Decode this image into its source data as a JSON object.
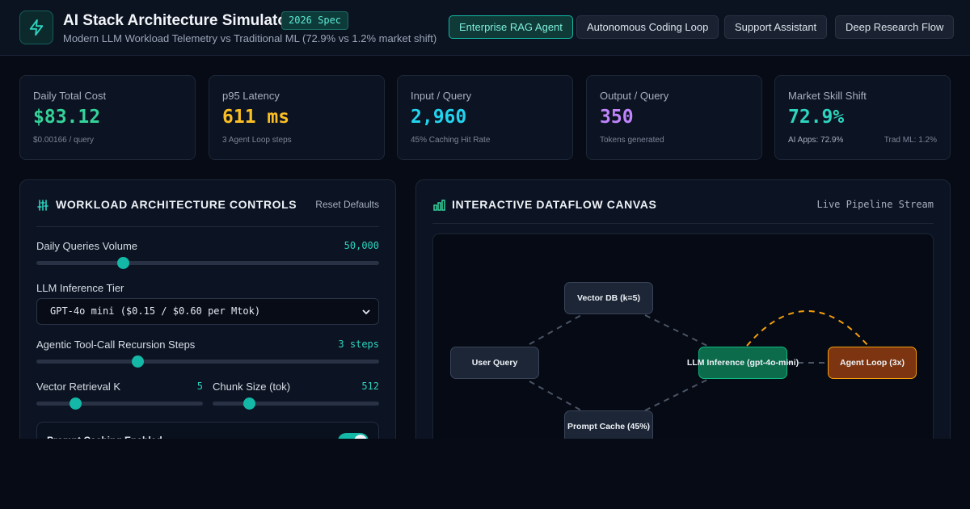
{
  "header": {
    "title": "AI Stack Architecture Simulator",
    "badge": "2026 Spec",
    "subtitle": "Modern LLM Workload Telemetry vs Traditional ML (72.9% vs 1.2% market shift)",
    "logo_icon": "lightning-icon",
    "presets": [
      {
        "label": "Enterprise RAG Agent",
        "active": true
      },
      {
        "label": "Autonomous Coding Loop",
        "active": false
      },
      {
        "label": "Support Assistant",
        "active": false
      },
      {
        "label": "Deep Research Flow",
        "active": false
      }
    ]
  },
  "stats": {
    "cost": {
      "label": "Daily Total Cost",
      "value": "$83.12",
      "sub": "$0.00166 / query",
      "color": "#34d399"
    },
    "latency": {
      "label": "p95 Latency",
      "value": "611 ms",
      "sub": "3 Agent Loop steps",
      "color": "#fbbf24"
    },
    "input": {
      "label": "Input / Query",
      "value": "2,960",
      "sub": "45% Caching Hit Rate",
      "color": "#22d3ee"
    },
    "output": {
      "label": "Output / Query",
      "value": "350",
      "sub": "Tokens generated",
      "color": "#c084fc"
    },
    "market": {
      "label": "Market Skill Shift",
      "value": "72.9%",
      "sub_left": "AI Apps: 72.9%",
      "sub_right": "Trad ML: 1.2%",
      "color": "#2dd4bf"
    }
  },
  "controls": {
    "title": "WORKLOAD ARCHITECTURE CONTROLS",
    "title_icon": "sliders-icon",
    "reset_label": "Reset Defaults",
    "queries": {
      "label": "Daily Queries Volume",
      "value": "50,000",
      "level": 0.25
    },
    "tier": {
      "label": "LLM Inference Tier",
      "selected": "GPT-4o mini ($0.15 / $0.60 per Mtok)"
    },
    "recursion": {
      "label": "Agentic Tool-Call Recursion Steps",
      "value": "3 steps",
      "level": 0.29
    },
    "retrieval_k": {
      "label": "Vector Retrieval K",
      "value": "5",
      "level": 0.23
    },
    "chunk": {
      "label": "Chunk Size (tok)",
      "value": "512",
      "level": 0.22
    },
    "caching": {
      "label": "Prompt Caching Enabled",
      "enabled": true
    }
  },
  "dataflow": {
    "title": "INTERACTIVE DATAFLOW CANVAS",
    "title_icon": "bar-chart-icon",
    "status": "Live Pipeline Stream",
    "nodes": {
      "user": "User Query",
      "vector": "Vector DB (k=5)",
      "cache": "Prompt Cache (45%)",
      "llm": "LLM Inference (gpt-4o-mini)",
      "agent": "Agent Loop (3x)"
    },
    "colors": {
      "accent": "#14b8a6",
      "llm": "#10b981",
      "agent": "#f59e0b"
    }
  }
}
